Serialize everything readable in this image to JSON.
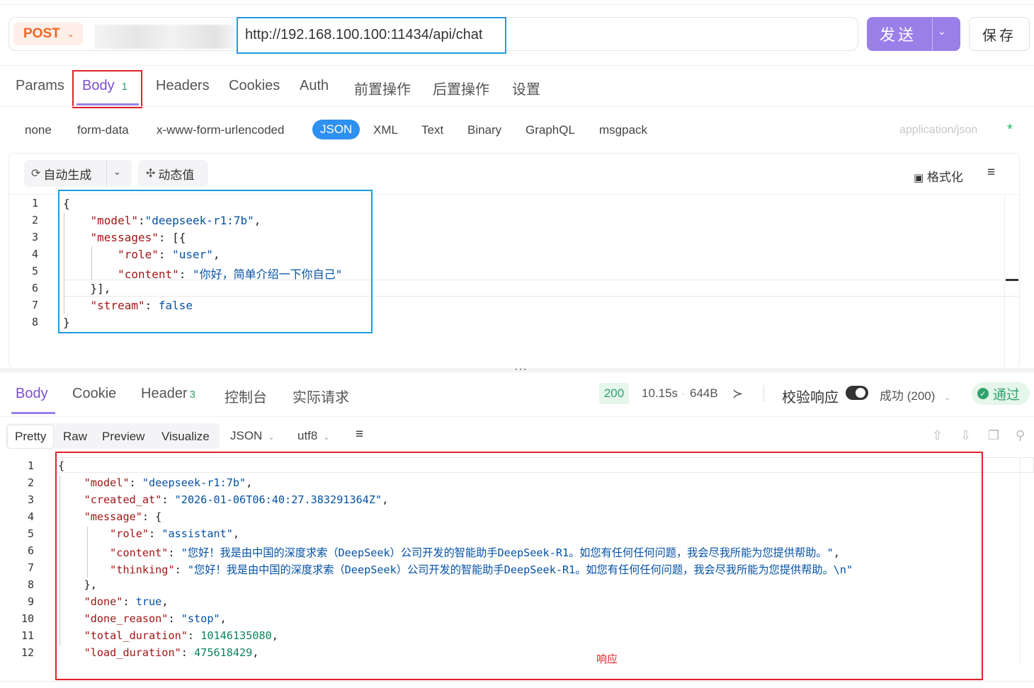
{
  "request": {
    "method": "POST",
    "url": "http://192.168.100.100:11434/api/chat",
    "send_label": "发送",
    "save_label": "保存"
  },
  "request_tabs": [
    {
      "label": "Params"
    },
    {
      "label": "Body",
      "badge": "1",
      "active": true
    },
    {
      "label": "Headers"
    },
    {
      "label": "Cookies"
    },
    {
      "label": "Auth"
    },
    {
      "label": "前置操作"
    },
    {
      "label": "后置操作"
    },
    {
      "label": "设置"
    }
  ],
  "body_types": [
    "none",
    "form-data",
    "x-www-form-urlencoded",
    "JSON",
    "XML",
    "Text",
    "Binary",
    "GraphQL",
    "msgpack"
  ],
  "body_type_active": "JSON",
  "content_type": "application/json",
  "required_mark": "*",
  "editor_toolbar": {
    "auto_generate": "自动生成",
    "dynamic_value": "动态值",
    "format": "格式化"
  },
  "request_body_lines": [
    "{",
    "    \"model\":\"deepseek-r1:7b\",",
    "    \"messages\": [{",
    "        \"role\": \"user\",",
    "        \"content\": \"你好，简单介绍一下你自己\"",
    "    }],",
    "    \"stream\": false",
    "}"
  ],
  "response_tabs": [
    {
      "label": "Body",
      "active": true
    },
    {
      "label": "Cookie"
    },
    {
      "label": "Header",
      "badge": "3"
    },
    {
      "label": "控制台"
    },
    {
      "label": "实际请求"
    }
  ],
  "response_meta": {
    "status_code": "200",
    "time": "10.15s",
    "size": "644B",
    "validate_label": "校验响应",
    "validate_on": true,
    "result_select": "成功 (200)",
    "pass_label": "通过"
  },
  "response_view": {
    "modes": [
      "Pretty",
      "Raw",
      "Preview",
      "Visualize"
    ],
    "active_mode": "Pretty",
    "format": "JSON",
    "encoding": "utf8"
  },
  "response_body_lines": [
    "{",
    "    \"model\": \"deepseek-r1:7b\",",
    "    \"created_at\": \"2026-01-06T06:40:27.383291364Z\",",
    "    \"message\": {",
    "        \"role\": \"assistant\",",
    "        \"content\": \"您好！我是由中国的深度求索（DeepSeek）公司开发的智能助手DeepSeek-R1。如您有任何任何问题，我会尽我所能为您提供帮助。\",",
    "        \"thinking\": \"您好！我是由中国的深度求索（DeepSeek）公司开发的智能助手DeepSeek-R1。如您有任何任何问题，我会尽我所能为您提供帮助。\\n\"",
    "    },",
    "    \"done\": true,",
    "    \"done_reason\": \"stop\",",
    "    \"total_duration\": 10146135080,",
    "    \"load_duration\": 475618429,"
  ],
  "annotation": "响应"
}
